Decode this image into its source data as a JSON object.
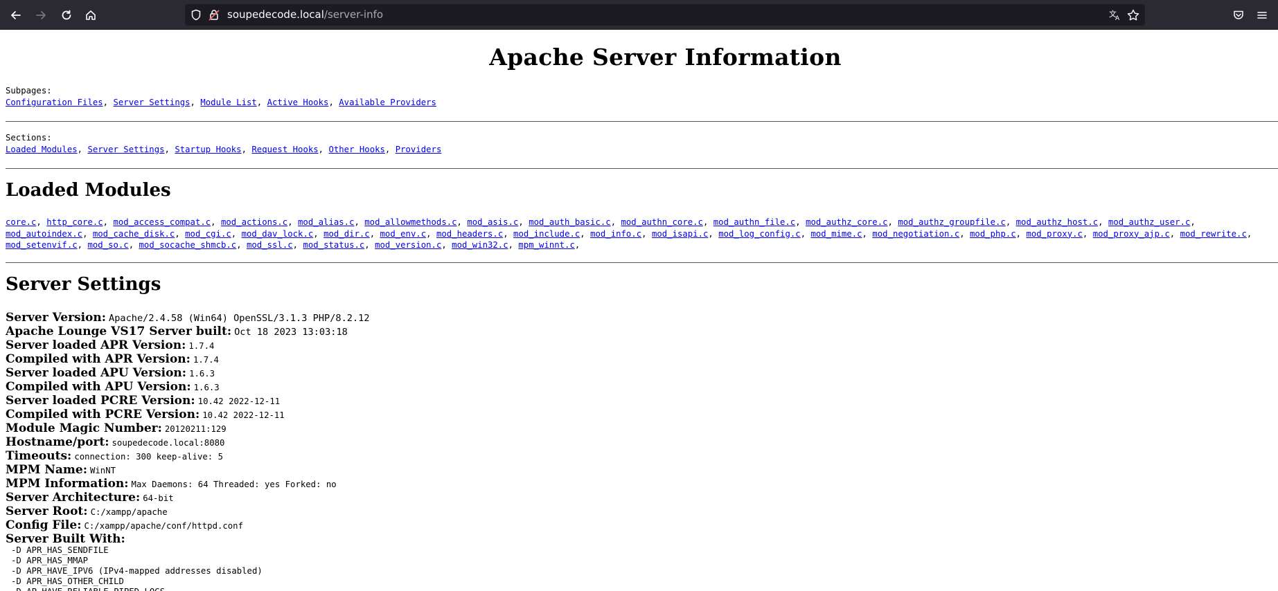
{
  "browser": {
    "url_host": "soupedecode.local",
    "url_path": "/server-info"
  },
  "page": {
    "title": "Apache Server Information",
    "subpages_label": "Subpages:",
    "subpages": [
      "Configuration Files",
      "Server Settings",
      "Module List",
      "Active Hooks",
      "Available Providers"
    ],
    "sections_label": "Sections:",
    "sections": [
      "Loaded Modules",
      "Server Settings",
      "Startup Hooks",
      "Request Hooks",
      "Other Hooks",
      "Providers"
    ],
    "loaded_modules_heading": "Loaded Modules",
    "modules": [
      "core.c",
      "http_core.c",
      "mod_access_compat.c",
      "mod_actions.c",
      "mod_alias.c",
      "mod_allowmethods.c",
      "mod_asis.c",
      "mod_auth_basic.c",
      "mod_authn_core.c",
      "mod_authn_file.c",
      "mod_authz_core.c",
      "mod_authz_groupfile.c",
      "mod_authz_host.c",
      "mod_authz_user.c",
      "mod_autoindex.c",
      "mod_cache_disk.c",
      "mod_cgi.c",
      "mod_dav_lock.c",
      "mod_dir.c",
      "mod_env.c",
      "mod_headers.c",
      "mod_include.c",
      "mod_info.c",
      "mod_isapi.c",
      "mod_log_config.c",
      "mod_mime.c",
      "mod_negotiation.c",
      "mod_php.c",
      "mod_proxy.c",
      "mod_proxy_ajp.c",
      "mod_rewrite.c",
      "mod_setenvif.c",
      "mod_so.c",
      "mod_socache_shmcb.c",
      "mod_ssl.c",
      "mod_status.c",
      "mod_version.c",
      "mod_win32.c",
      "mpm_winnt.c"
    ],
    "server_settings_heading": "Server Settings",
    "settings": [
      {
        "key": "Server Version:",
        "value": "Apache/2.4.58 (Win64) OpenSSL/3.1.3 PHP/8.2.12",
        "big": true
      },
      {
        "key": "Apache Lounge VS17 Server built:",
        "value": "Oct 18 2023 13:03:18",
        "big": true
      },
      {
        "key": "Server loaded APR Version:",
        "value": "1.7.4"
      },
      {
        "key": "Compiled with APR Version:",
        "value": "1.7.4"
      },
      {
        "key": "Server loaded APU Version:",
        "value": "1.6.3"
      },
      {
        "key": "Compiled with APU Version:",
        "value": "1.6.3"
      },
      {
        "key": "Server loaded PCRE Version:",
        "value": "10.42 2022-12-11"
      },
      {
        "key": "Compiled with PCRE Version:",
        "value": "10.42 2022-12-11"
      },
      {
        "key": "Module Magic Number:",
        "value": "20120211:129"
      },
      {
        "key": "Hostname/port:",
        "value": "soupedecode.local:8080"
      },
      {
        "key": "Timeouts:",
        "value": "connection: 300    keep-alive: 5"
      },
      {
        "key": "MPM Name:",
        "value": "WinNT"
      },
      {
        "key": "MPM Information:",
        "value": "Max Daemons: 64 Threaded: yes Forked: no"
      },
      {
        "key": "Server Architecture:",
        "value": "64-bit"
      },
      {
        "key": "Server Root:",
        "value": "C:/xampp/apache"
      },
      {
        "key": "Config File:",
        "value": "C:/xampp/apache/conf/httpd.conf"
      },
      {
        "key": "Server Built With:",
        "value": ""
      }
    ],
    "built_with": [
      "-D APR_HAS_SENDFILE",
      "-D APR_HAS_MMAP",
      "-D APR_HAVE_IPV6 (IPv4-mapped addresses disabled)",
      "-D APR_HAS_OTHER_CHILD",
      "-D AP_HAVE_RELIABLE_PIPED_LOGS"
    ]
  }
}
